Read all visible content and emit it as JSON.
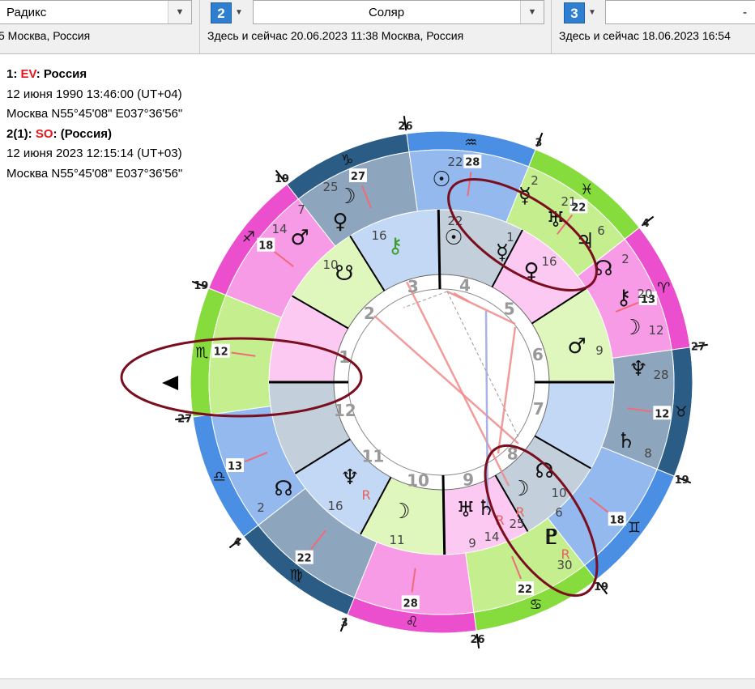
{
  "panels": [
    {
      "combo_value": "Радикс",
      "subtitle": "5 Москва, Россия"
    },
    {
      "number": "2",
      "combo_value": "Соляр",
      "subtitle": "Здесь и сейчас 20.06.2023 11:38 Москва, Россия"
    },
    {
      "number": "3",
      "combo_value": "-",
      "subtitle": "Здесь и сейчас 18.06.2023 16:54"
    }
  ],
  "info": {
    "line1_prefix": "1: ",
    "line1_code": "EV",
    "line1_sep": ": ",
    "line1_name": "Россия",
    "line2": "12 июня 1990 13:46:00 (UT+04)",
    "line3": "Москва N55°45'08\" E037°36'56\"",
    "line4_prefix": "2(1): ",
    "line4_code": "SO",
    "line4_sep": ": ",
    "line4_name": "(Россия)",
    "line5": "12 июня 2023 12:15:14 (UT+03)",
    "line6": "Москва N55°45'08\" E037°36'56\""
  },
  "chart": {
    "zodiac_glyphs": [
      "♋",
      "♊",
      "♉",
      "♈",
      "♓",
      "♒",
      "♑",
      "♐",
      "♏",
      "♎",
      "♍",
      "♌"
    ],
    "outer_degrees": [
      "26",
      "19",
      "19",
      "27",
      "4",
      "3",
      "26",
      "19",
      "19",
      "27",
      "4",
      "3"
    ],
    "inner_degrees": [
      "22",
      "18",
      "12",
      "13",
      "22",
      "28",
      "27",
      "18",
      "12",
      "13",
      "22",
      "28"
    ],
    "house_numbers": [
      "1",
      "2",
      "3",
      "4",
      "5",
      "6",
      "7",
      "8",
      "9",
      "10",
      "11",
      "12"
    ],
    "outer_planets": [
      {
        "glyph": "☉",
        "deg": "22"
      },
      {
        "glyph": "☿",
        "deg": "2"
      },
      {
        "glyph": "♅",
        "deg": "21"
      },
      {
        "glyph": "♃",
        "deg": "6"
      },
      {
        "glyph": "☊",
        "deg": "2"
      },
      {
        "glyph": "⚷",
        "deg": "20"
      },
      {
        "glyph": "☽",
        "deg": "12"
      },
      {
        "glyph": "♆",
        "deg": "28"
      },
      {
        "glyph": "♄",
        "deg": "8"
      },
      {
        "glyph": "♇",
        "deg": "30"
      },
      {
        "glyph": "♀",
        "deg": "7"
      },
      {
        "glyph": "♂",
        "deg": "14"
      },
      {
        "glyph": "☽",
        "deg": "25"
      },
      {
        "glyph": "☊",
        "deg": "2"
      }
    ],
    "inner_planets": [
      {
        "glyph": "☉",
        "deg": "22"
      },
      {
        "glyph": "☿",
        "deg": "1"
      },
      {
        "glyph": "♀",
        "deg": "16"
      },
      {
        "glyph": "⚷",
        "deg": "16"
      },
      {
        "glyph": "☋",
        "deg": "10"
      },
      {
        "glyph": "♂",
        "deg": "9"
      },
      {
        "glyph": "♆",
        "deg": "16"
      },
      {
        "glyph": "☽",
        "deg": "11"
      },
      {
        "glyph": "♅",
        "deg": "9"
      },
      {
        "glyph": "♄",
        "deg": "14"
      },
      {
        "glyph": "☊",
        "deg": "10"
      },
      {
        "glyph": "♇",
        "deg": "6"
      },
      {
        "glyph": "☽",
        "deg": "25"
      }
    ],
    "retro_mark": "R",
    "colors": {
      "fire": "#e83ecb",
      "earth": "#7fd93a",
      "air": "#4a8fe0",
      "water": "#2a5d86",
      "aspect_red": "#f08a8a",
      "aspect_blue": "#9aa8e0",
      "annotation": "#7a0d1e"
    }
  }
}
